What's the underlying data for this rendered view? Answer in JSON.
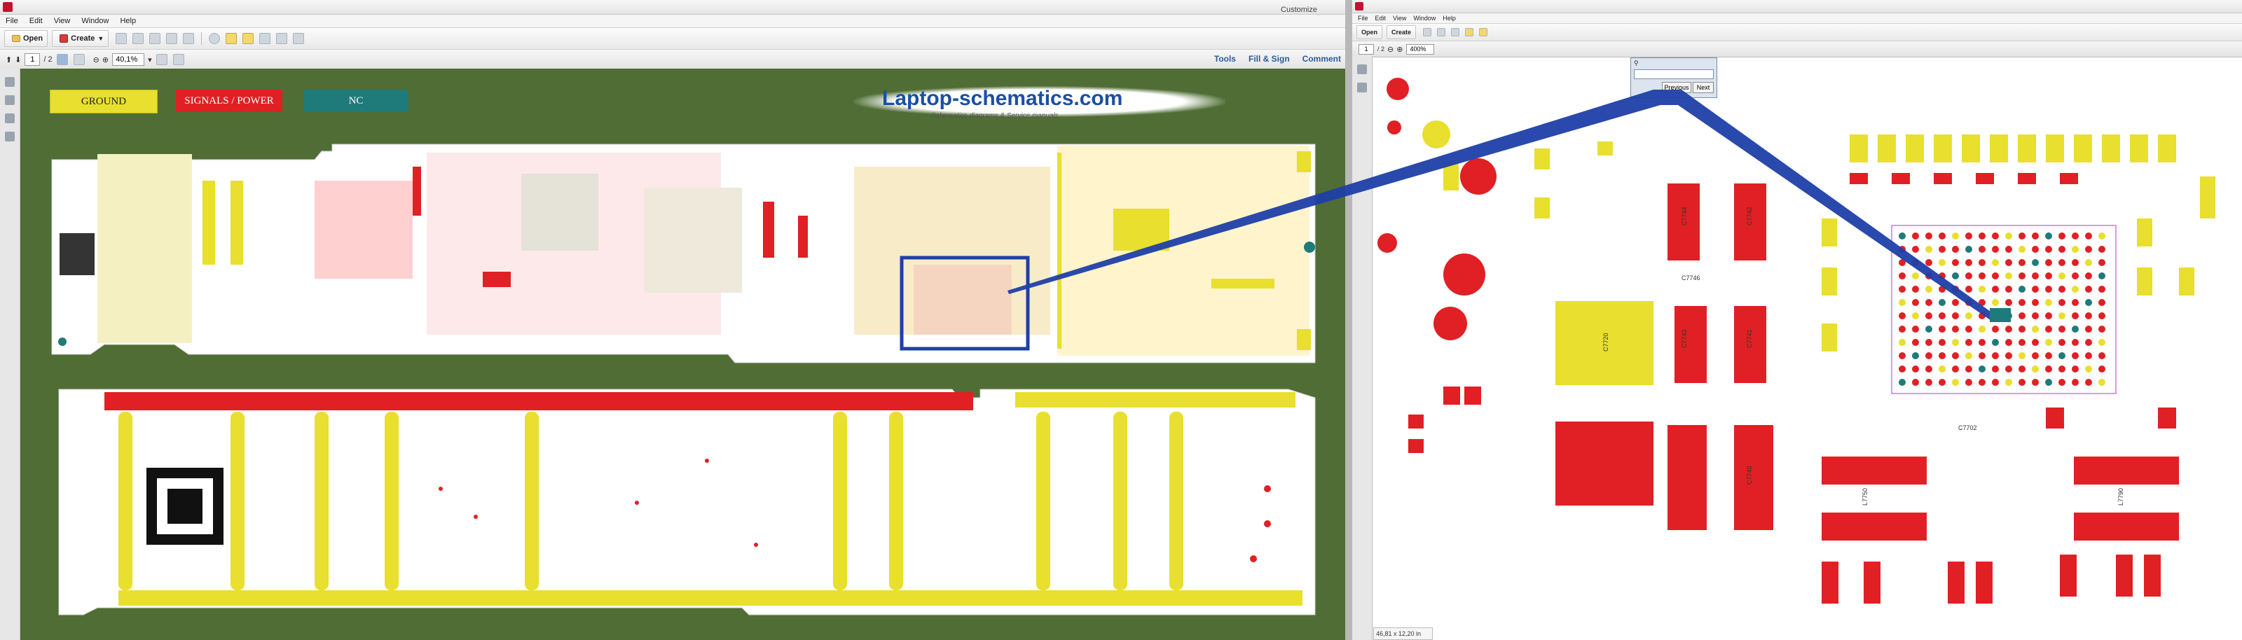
{
  "left_window": {
    "menus": [
      "File",
      "Edit",
      "View",
      "Window",
      "Help"
    ],
    "open_label": "Open",
    "create_label": "Create",
    "customize_label": "Customize",
    "page_value": "1",
    "page_total": "/ 2",
    "zoom_value": "40,1%",
    "right_links": [
      "Tools",
      "Fill & Sign",
      "Comment"
    ],
    "legend": {
      "ground": "GROUND",
      "signals_power": "SIGNALS / POWER",
      "nc": "NC"
    },
    "watermark": "Laptop-schematics.com",
    "watermark_sub": "Schematics diagrams & Service manuals"
  },
  "right_window": {
    "menus": [
      "File",
      "Edit",
      "View",
      "Window",
      "Help"
    ],
    "open_label": "Open",
    "create_label": "Create",
    "page_value": "1",
    "page_total": "/ 2",
    "zoom_value": "400%",
    "find": {
      "previous": "Previous",
      "next": "Next"
    },
    "status_text": "46,81 x 12,20 in",
    "component_labels": [
      {
        "id": "c1",
        "label": "C7744"
      },
      {
        "id": "c2",
        "label": "C7743"
      },
      {
        "id": "c3",
        "label": "C7742"
      },
      {
        "id": "c4",
        "label": "C7720"
      },
      {
        "id": "c5",
        "label": "C7746"
      },
      {
        "id": "c6",
        "label": "L7790"
      },
      {
        "id": "c7",
        "label": "L7750"
      },
      {
        "id": "c8",
        "label": "C7741"
      },
      {
        "id": "c9",
        "label": "C7740"
      },
      {
        "id": "c10",
        "label": "C7702"
      }
    ]
  },
  "colors": {
    "ground": "#e8df2e",
    "signals_power": "#e02024",
    "nc": "#1f7a7a",
    "board_bg": "#4f6d34",
    "highlight": "#1f3fa8"
  }
}
